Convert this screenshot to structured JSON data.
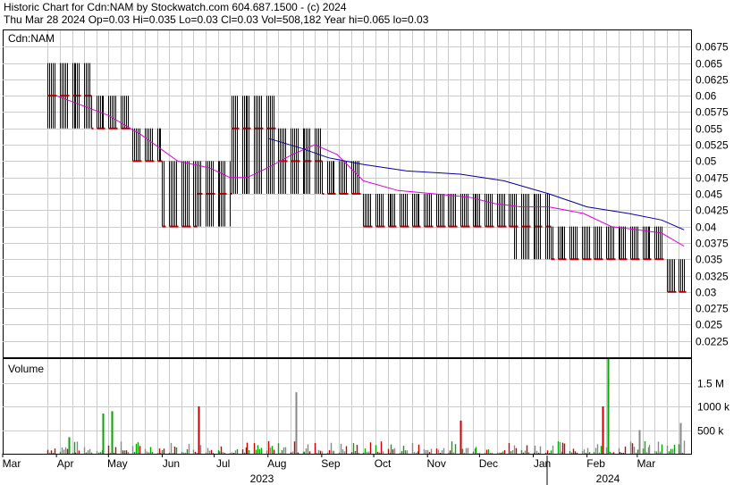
{
  "header": {
    "line1": "Historic Chart for Cdn:NAM by Stockwatch.com 604.687.1500 - (c) 2024",
    "line2": "Thu Mar 28 2024   Op=0.03   Hi=0.035   Lo=0.03   Cl=0.03   Vol=508,182   Year hi=0.065   lo=0.03"
  },
  "colors": {
    "up_bar": "#000000",
    "close_tick": "#d40000",
    "ma_short": "#dd00dd",
    "ma_long": "#0000aa",
    "volume_up": "#00aa00",
    "volume_down": "#cc0000",
    "volume_flat": "#888888",
    "grid": "#cccccc"
  },
  "chart_data": [
    {
      "type": "line",
      "title": "Cdn:NAM",
      "ylim": [
        0.02,
        0.07
      ],
      "y_ticks": [
        "0.0675",
        "0.065",
        "0.0625",
        "0.06",
        "0.0575",
        "0.055",
        "0.0525",
        "0.05",
        "0.0475",
        "0.045",
        "0.0425",
        "0.04",
        "0.0375",
        "0.035",
        "0.0325",
        "0.03",
        "0.0275",
        "0.025",
        "0.0225"
      ],
      "x_months": [
        "Mar",
        "Apr",
        "May",
        "Jun",
        "Jul",
        "Aug",
        "Sep",
        "Oct",
        "Nov",
        "Dec",
        "Jan",
        "Feb",
        "Mar"
      ],
      "x_years": [
        "2023",
        "2024"
      ],
      "price_segments": [
        {
          "start": "2023-03-27",
          "end": "2023-04-20",
          "lo": 0.055,
          "hi": 0.065,
          "close": 0.06
        },
        {
          "start": "2023-04-21",
          "end": "2023-05-12",
          "lo": 0.055,
          "hi": 0.06,
          "close": 0.055
        },
        {
          "start": "2023-05-13",
          "end": "2023-05-31",
          "lo": 0.05,
          "hi": 0.055,
          "close": 0.05
        },
        {
          "start": "2023-06-01",
          "end": "2023-06-20",
          "lo": 0.04,
          "hi": 0.05,
          "close": 0.04
        },
        {
          "start": "2023-06-21",
          "end": "2023-07-10",
          "lo": 0.04,
          "hi": 0.05,
          "close": 0.045
        },
        {
          "start": "2023-07-11",
          "end": "2023-08-05",
          "lo": 0.045,
          "hi": 0.06,
          "close": 0.055
        },
        {
          "start": "2023-08-06",
          "end": "2023-08-31",
          "lo": 0.045,
          "hi": 0.055,
          "close": 0.05
        },
        {
          "start": "2023-09-01",
          "end": "2023-09-22",
          "lo": 0.045,
          "hi": 0.05,
          "close": 0.045
        },
        {
          "start": "2023-09-23",
          "end": "2023-12-20",
          "lo": 0.04,
          "hi": 0.045,
          "close": 0.04
        },
        {
          "start": "2023-12-21",
          "end": "2024-01-10",
          "lo": 0.035,
          "hi": 0.045,
          "close": 0.04
        },
        {
          "start": "2024-01-11",
          "end": "2024-02-05",
          "lo": 0.035,
          "hi": 0.04,
          "close": 0.035
        },
        {
          "start": "2024-02-06",
          "end": "2024-03-15",
          "lo": 0.035,
          "hi": 0.04,
          "close": 0.035
        },
        {
          "start": "2024-03-16",
          "end": "2024-03-28",
          "lo": 0.03,
          "hi": 0.035,
          "close": 0.03
        }
      ],
      "series": [
        {
          "x": [
            "2023-04-01",
            "2023-05-01",
            "2023-05-20",
            "2023-06-10",
            "2023-06-28",
            "2023-07-10",
            "2023-07-20",
            "2023-08-01",
            "2023-08-15",
            "2023-08-28",
            "2023-09-10",
            "2023-09-25",
            "2023-10-15",
            "2023-11-05",
            "2023-11-25",
            "2023-12-10",
            "2023-12-25",
            "2024-01-10",
            "2024-01-30",
            "2024-02-15",
            "2024-03-01",
            "2024-03-15",
            "2024-03-28"
          ],
          "values": [
            0.06,
            0.057,
            0.054,
            0.05,
            0.049,
            0.0475,
            0.0475,
            0.049,
            0.051,
            0.0525,
            0.051,
            0.047,
            0.0455,
            0.045,
            0.0445,
            0.0435,
            0.043,
            0.043,
            0.042,
            0.04,
            0.0395,
            0.039,
            0.037
          ]
        },
        {
          "x": [
            "2023-08-01",
            "2023-08-20",
            "2023-09-05",
            "2023-09-25",
            "2023-10-20",
            "2023-11-20",
            "2023-12-15",
            "2024-01-10",
            "2024-02-01",
            "2024-02-25",
            "2024-03-15",
            "2024-03-28"
          ],
          "values": [
            0.0535,
            0.052,
            0.0505,
            0.0495,
            0.0485,
            0.048,
            0.047,
            0.045,
            0.043,
            0.042,
            0.041,
            0.0395
          ]
        }
      ]
    },
    {
      "type": "bar",
      "title": "Volume",
      "ylim": [
        0,
        2000000
      ],
      "y_ticks": [
        "1.5 M",
        "1000 k",
        "500 k"
      ],
      "volume_spikes": [
        {
          "date": "2023-04-08",
          "value": 350000,
          "dir": "up"
        },
        {
          "date": "2023-04-28",
          "value": 850000,
          "dir": "up"
        },
        {
          "date": "2023-05-03",
          "value": 900000,
          "dir": "up"
        },
        {
          "date": "2023-06-22",
          "value": 1000000,
          "dir": "down"
        },
        {
          "date": "2023-08-17",
          "value": 1300000,
          "dir": "flat"
        },
        {
          "date": "2023-11-20",
          "value": 700000,
          "dir": "down"
        },
        {
          "date": "2024-02-10",
          "value": 1000000,
          "dir": "down"
        },
        {
          "date": "2024-02-13",
          "value": 2000000,
          "dir": "up"
        },
        {
          "date": "2024-03-02",
          "value": 500000,
          "dir": "flat"
        },
        {
          "date": "2024-03-26",
          "value": 650000,
          "dir": "flat"
        }
      ]
    }
  ]
}
